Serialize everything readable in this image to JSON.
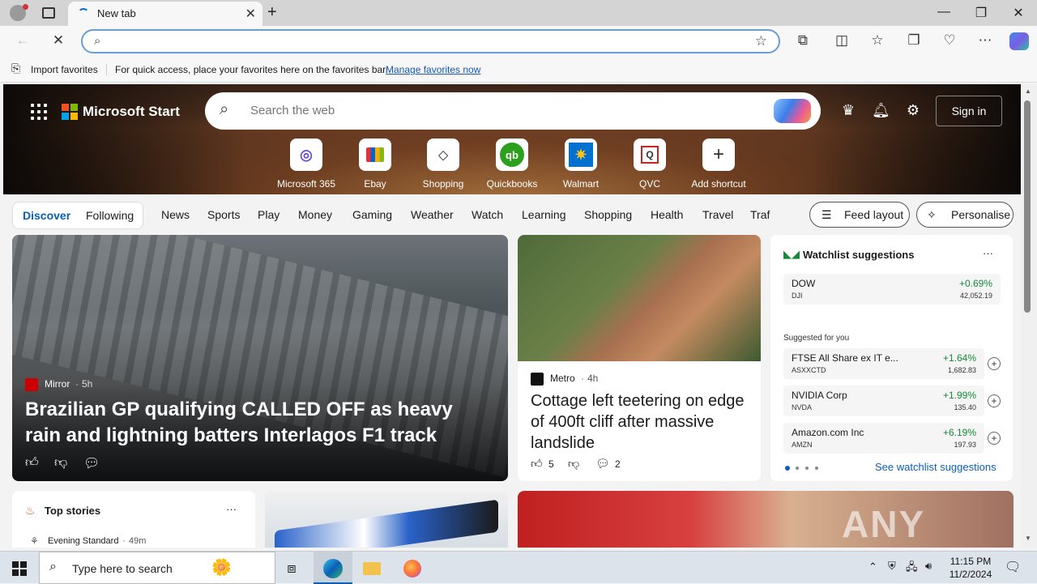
{
  "browser": {
    "tab_title": "New tab",
    "new_tab": "+",
    "minimize": "—",
    "restore": "❐",
    "close": "✕",
    "favbar": {
      "import": "Import favorites",
      "hint": "For quick access, place your favorites here on the favorites bar.",
      "manage": "Manage favorites now"
    }
  },
  "header": {
    "brand": "Microsoft Start",
    "search_placeholder": "Search the web",
    "sign_in": "Sign in"
  },
  "shortcuts": [
    {
      "label": "Microsoft 365",
      "glyph": "◎",
      "color": "#6b4fd8"
    },
    {
      "label": "Ebay",
      "glyph": "🛍",
      "color": "#333"
    },
    {
      "label": "Shopping",
      "glyph": "🏷",
      "color": "#333"
    },
    {
      "label": "Quickbooks",
      "glyph": "qb",
      "color": "#2ca01c"
    },
    {
      "label": "Walmart",
      "glyph": "✷",
      "color": "#0071ce"
    },
    {
      "label": "QVC",
      "glyph": "Q",
      "color": "#c22"
    },
    {
      "label": "Add shortcut",
      "glyph": "+",
      "color": "#333"
    }
  ],
  "nav": {
    "discover": "Discover",
    "following": "Following",
    "items": [
      "News",
      "Sports",
      "Play",
      "Money",
      "Gaming",
      "Weather",
      "Watch",
      "Learning",
      "Shopping",
      "Health",
      "Travel",
      "Traf"
    ],
    "feed_layout": "Feed layout",
    "personalise": "Personalise"
  },
  "card1": {
    "source": "Mirror",
    "time": "5h",
    "headline": "Brazilian GP qualifying CALLED OFF as heavy rain and lightning batters Interlagos F1 track"
  },
  "card2": {
    "source": "Metro",
    "time": "4h",
    "headline": "Cottage left teetering on edge of 400ft cliff after massive landslide",
    "likes": "5",
    "comments": "2"
  },
  "watchlist": {
    "title": "Watchlist suggestions",
    "more": "···",
    "main": {
      "name": "DOW",
      "ticker": "DJI",
      "change": "+0.69%",
      "price": "42,052.19"
    },
    "suggested_label": "Suggested for you",
    "stocks": [
      {
        "name": "FTSE All Share ex IT e...",
        "ticker": "ASXXCTD",
        "change": "+1.64%",
        "price": "1,682.83"
      },
      {
        "name": "NVIDIA Corp",
        "ticker": "NVDA",
        "change": "+1.99%",
        "price": "135.40"
      },
      {
        "name": "Amazon.com Inc",
        "ticker": "AMZN",
        "change": "+6.19%",
        "price": "197.93"
      }
    ],
    "see_all": "See watchlist suggestions"
  },
  "top_stories": {
    "title": "Top stories",
    "more": "···",
    "source": "Evening Standard",
    "time": "49m"
  },
  "watermark": "ANY RUN",
  "taskbar": {
    "search": "Type here to search",
    "time": "11:15 PM",
    "date": "11/2/2024"
  }
}
